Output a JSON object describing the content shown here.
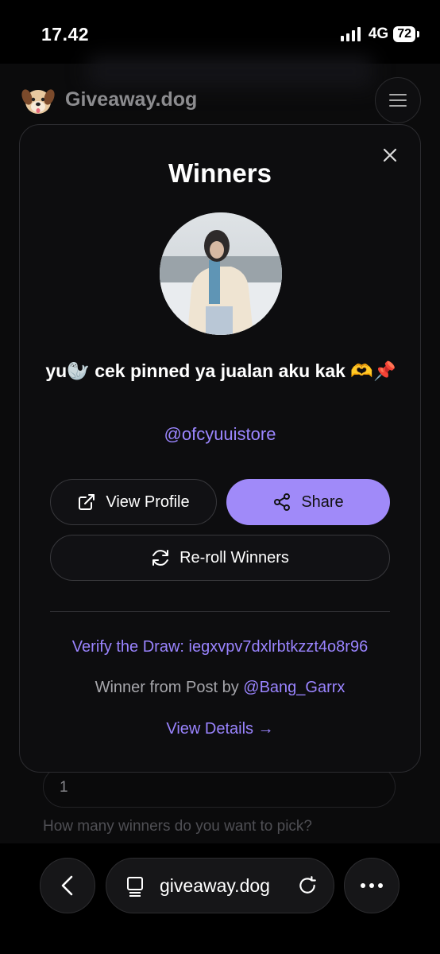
{
  "status_bar": {
    "time": "17.42",
    "network": "4G",
    "battery": "72"
  },
  "site": {
    "name": "Giveaway.dog"
  },
  "modal": {
    "title": "Winners",
    "winner_display_name": "yu🦭 cek pinned ya jualan aku kak 🫶📌",
    "winner_handle": "@ofcyuuistore",
    "view_profile_label": "View Profile",
    "share_label": "Share",
    "reroll_label": "Re-roll Winners",
    "verify_text": "Verify the Draw: iegxvpv7dxlrbtkzzt4o8r96",
    "winner_from_prefix": "Winner from Post by ",
    "winner_from_user": "@Bang_Garrx",
    "view_details_label": "View Details →"
  },
  "background_form": {
    "winners_count_value": "1",
    "winners_help": "How many winners do you want to pick?"
  },
  "browser": {
    "url": "giveaway.dog"
  },
  "colors": {
    "accent": "#a08af9",
    "link": "#9a84ff",
    "background": "#000000",
    "modal_bg": "#0d0d0f"
  },
  "icons": [
    "signal-icon",
    "battery-icon",
    "dog-logo-icon",
    "menu-icon",
    "close-icon",
    "external-link-icon",
    "share-icon",
    "refresh-icon",
    "back-icon",
    "tabs-icon",
    "reload-icon",
    "more-icon"
  ]
}
